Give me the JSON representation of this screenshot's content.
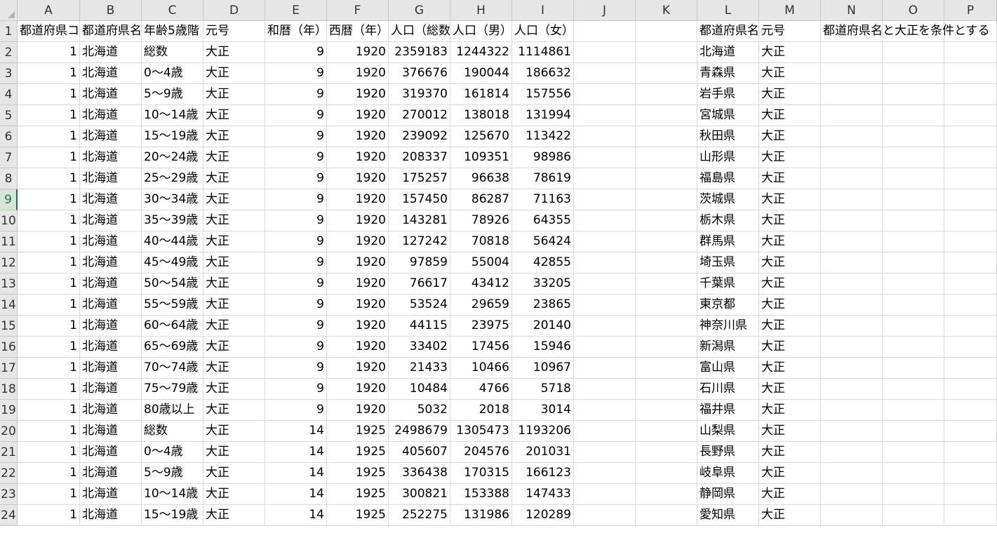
{
  "columns": [
    "A",
    "B",
    "C",
    "D",
    "E",
    "F",
    "G",
    "H",
    "I",
    "J",
    "K",
    "L",
    "M",
    "N",
    "O",
    "P"
  ],
  "rows": [
    {
      "n": "1",
      "a": "都道府県コ",
      "b": "都道府県名",
      "c": "年齢5歳階",
      "d": "元号",
      "e": "和暦（年）",
      "f": "西暦（年）",
      "g": "人口（総数",
      "h": "人口（男）",
      "i": "人口（女）",
      "l": "都道府県名",
      "m": "元号",
      "n_col": "都道府県名と大正を条件とする"
    },
    {
      "n": "2",
      "a": "1",
      "b": "北海道",
      "c": "総数",
      "d": "大正",
      "e": "9",
      "f": "1920",
      "g": "2359183",
      "h": "1244322",
      "i": "1114861",
      "l": "北海道",
      "m": "大正",
      "n_col": ""
    },
    {
      "n": "3",
      "a": "1",
      "b": "北海道",
      "c": "0～4歳",
      "d": "大正",
      "e": "9",
      "f": "1920",
      "g": "376676",
      "h": "190044",
      "i": "186632",
      "l": "青森県",
      "m": "大正",
      "n_col": ""
    },
    {
      "n": "4",
      "a": "1",
      "b": "北海道",
      "c": "5～9歳",
      "d": "大正",
      "e": "9",
      "f": "1920",
      "g": "319370",
      "h": "161814",
      "i": "157556",
      "l": "岩手県",
      "m": "大正",
      "n_col": ""
    },
    {
      "n": "5",
      "a": "1",
      "b": "北海道",
      "c": "10～14歳",
      "d": "大正",
      "e": "9",
      "f": "1920",
      "g": "270012",
      "h": "138018",
      "i": "131994",
      "l": "宮城県",
      "m": "大正",
      "n_col": ""
    },
    {
      "n": "6",
      "a": "1",
      "b": "北海道",
      "c": "15～19歳",
      "d": "大正",
      "e": "9",
      "f": "1920",
      "g": "239092",
      "h": "125670",
      "i": "113422",
      "l": "秋田県",
      "m": "大正",
      "n_col": ""
    },
    {
      "n": "7",
      "a": "1",
      "b": "北海道",
      "c": "20～24歳",
      "d": "大正",
      "e": "9",
      "f": "1920",
      "g": "208337",
      "h": "109351",
      "i": "98986",
      "l": "山形県",
      "m": "大正",
      "n_col": ""
    },
    {
      "n": "8",
      "a": "1",
      "b": "北海道",
      "c": "25～29歳",
      "d": "大正",
      "e": "9",
      "f": "1920",
      "g": "175257",
      "h": "96638",
      "i": "78619",
      "l": "福島県",
      "m": "大正",
      "n_col": ""
    },
    {
      "n": "9",
      "a": "1",
      "b": "北海道",
      "c": "30～34歳",
      "d": "大正",
      "e": "9",
      "f": "1920",
      "g": "157450",
      "h": "86287",
      "i": "71163",
      "l": "茨城県",
      "m": "大正",
      "n_col": ""
    },
    {
      "n": "10",
      "a": "1",
      "b": "北海道",
      "c": "35～39歳",
      "d": "大正",
      "e": "9",
      "f": "1920",
      "g": "143281",
      "h": "78926",
      "i": "64355",
      "l": "栃木県",
      "m": "大正",
      "n_col": ""
    },
    {
      "n": "11",
      "a": "1",
      "b": "北海道",
      "c": "40～44歳",
      "d": "大正",
      "e": "9",
      "f": "1920",
      "g": "127242",
      "h": "70818",
      "i": "56424",
      "l": "群馬県",
      "m": "大正",
      "n_col": ""
    },
    {
      "n": "12",
      "a": "1",
      "b": "北海道",
      "c": "45～49歳",
      "d": "大正",
      "e": "9",
      "f": "1920",
      "g": "97859",
      "h": "55004",
      "i": "42855",
      "l": "埼玉県",
      "m": "大正",
      "n_col": ""
    },
    {
      "n": "13",
      "a": "1",
      "b": "北海道",
      "c": "50～54歳",
      "d": "大正",
      "e": "9",
      "f": "1920",
      "g": "76617",
      "h": "43412",
      "i": "33205",
      "l": "千葉県",
      "m": "大正",
      "n_col": ""
    },
    {
      "n": "14",
      "a": "1",
      "b": "北海道",
      "c": "55～59歳",
      "d": "大正",
      "e": "9",
      "f": "1920",
      "g": "53524",
      "h": "29659",
      "i": "23865",
      "l": "東京都",
      "m": "大正",
      "n_col": ""
    },
    {
      "n": "15",
      "a": "1",
      "b": "北海道",
      "c": "60～64歳",
      "d": "大正",
      "e": "9",
      "f": "1920",
      "g": "44115",
      "h": "23975",
      "i": "20140",
      "l": "神奈川県",
      "m": "大正",
      "n_col": ""
    },
    {
      "n": "16",
      "a": "1",
      "b": "北海道",
      "c": "65～69歳",
      "d": "大正",
      "e": "9",
      "f": "1920",
      "g": "33402",
      "h": "17456",
      "i": "15946",
      "l": "新潟県",
      "m": "大正",
      "n_col": ""
    },
    {
      "n": "17",
      "a": "1",
      "b": "北海道",
      "c": "70～74歳",
      "d": "大正",
      "e": "9",
      "f": "1920",
      "g": "21433",
      "h": "10466",
      "i": "10967",
      "l": "富山県",
      "m": "大正",
      "n_col": ""
    },
    {
      "n": "18",
      "a": "1",
      "b": "北海道",
      "c": "75～79歳",
      "d": "大正",
      "e": "9",
      "f": "1920",
      "g": "10484",
      "h": "4766",
      "i": "5718",
      "l": "石川県",
      "m": "大正",
      "n_col": ""
    },
    {
      "n": "19",
      "a": "1",
      "b": "北海道",
      "c": "80歳以上",
      "d": "大正",
      "e": "9",
      "f": "1920",
      "g": "5032",
      "h": "2018",
      "i": "3014",
      "l": "福井県",
      "m": "大正",
      "n_col": ""
    },
    {
      "n": "20",
      "a": "1",
      "b": "北海道",
      "c": "総数",
      "d": "大正",
      "e": "14",
      "f": "1925",
      "g": "2498679",
      "h": "1305473",
      "i": "1193206",
      "l": "山梨県",
      "m": "大正",
      "n_col": ""
    },
    {
      "n": "21",
      "a": "1",
      "b": "北海道",
      "c": "0～4歳",
      "d": "大正",
      "e": "14",
      "f": "1925",
      "g": "405607",
      "h": "204576",
      "i": "201031",
      "l": "長野県",
      "m": "大正",
      "n_col": ""
    },
    {
      "n": "22",
      "a": "1",
      "b": "北海道",
      "c": "5～9歳",
      "d": "大正",
      "e": "14",
      "f": "1925",
      "g": "336438",
      "h": "170315",
      "i": "166123",
      "l": "岐阜県",
      "m": "大正",
      "n_col": ""
    },
    {
      "n": "23",
      "a": "1",
      "b": "北海道",
      "c": "10～14歳",
      "d": "大正",
      "e": "14",
      "f": "1925",
      "g": "300821",
      "h": "153388",
      "i": "147433",
      "l": "静岡県",
      "m": "大正",
      "n_col": ""
    },
    {
      "n": "24",
      "a": "1",
      "b": "北海道",
      "c": "15～19歳",
      "d": "大正",
      "e": "14",
      "f": "1925",
      "g": "252275",
      "h": "131986",
      "i": "120289",
      "l": "愛知県",
      "m": "大正",
      "n_col": ""
    }
  ],
  "active_row": "9",
  "colors": {
    "header_bg": "#e6e6e6",
    "gridline": "#d9d9d9",
    "accent": "#217346"
  }
}
